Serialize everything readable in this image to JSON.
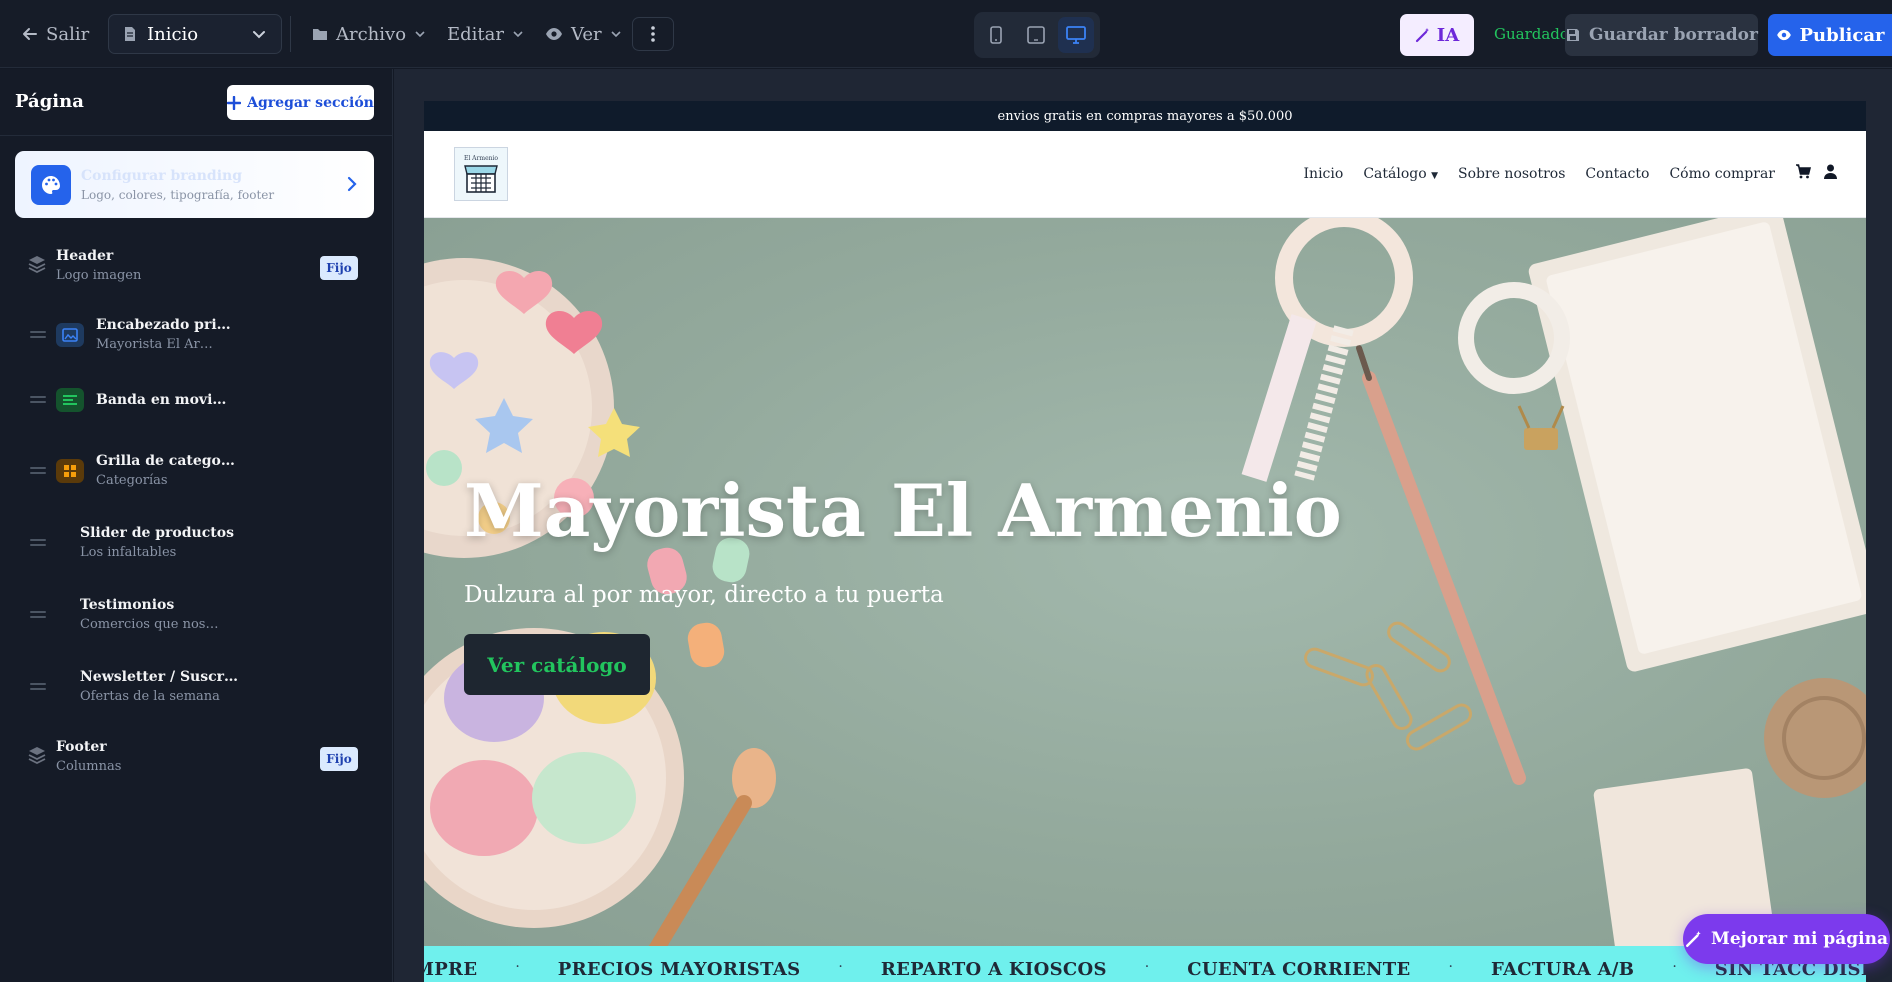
{
  "topbar": {
    "exit_label": "Salir",
    "page_select_value": "Inicio",
    "menu_archivo": "Archivo",
    "menu_editar": "Editar",
    "menu_ver": "Ver",
    "ia_label": "IA",
    "saved_status": "Guardado",
    "draft_label": "Guardar borrador",
    "publish_label": "Publicar",
    "active_device": "desktop"
  },
  "sidebar": {
    "title": "Página",
    "add_section_label": "Agregar sección",
    "branding": {
      "title": "Configurar branding",
      "subtitle": "Logo, colores, tipografía, footer"
    },
    "sections": [
      {
        "title": "Header",
        "subtitle": "Logo imagen",
        "badge": "Fijo",
        "icon": "layers-icon"
      },
      {
        "title": "Encabezado pri…",
        "subtitle": "Mayorista El Ar…",
        "icon": "image-icon",
        "color": "#2563eb"
      },
      {
        "title": "Banda en movi…",
        "subtitle": "",
        "icon": "lines-icon",
        "color": "#16a34a"
      },
      {
        "title": "Grilla de catego…",
        "subtitle": "Categorías",
        "icon": "grid-icon",
        "color": "#f59e0b"
      },
      {
        "title": "Slider de productos",
        "subtitle": "Los infaltables"
      },
      {
        "title": "Testimonios",
        "subtitle": "Comercios que nos…"
      },
      {
        "title": "Newsletter / Suscr…",
        "subtitle": "Ofertas de la semana"
      },
      {
        "title": "Footer",
        "subtitle": "Columnas",
        "badge": "Fijo",
        "icon": "layers-icon"
      }
    ]
  },
  "site": {
    "announcement": "envios gratis en compras mayores a $50.000",
    "logo_text": "El Armenio",
    "nav": [
      "Inicio",
      "Catálogo",
      "Sobre nosotros",
      "Contacto",
      "Cómo comprar"
    ],
    "hero_title": "Mayorista El Armenio",
    "hero_subtitle": "Dulzura al por mayor, directo a tu puerta",
    "hero_cta": "Ver catálogo",
    "marquee": [
      "MPRE",
      "PRECIOS MAYORISTAS",
      "REPARTO A KIOSCOS",
      "CUENTA CORRIENTE",
      "FACTURA A/B",
      "SIN TACC DISP"
    ],
    "marquee_separator": "·"
  },
  "improve_label": "Mejorar mi página",
  "colors": {
    "accent_blue": "#2563eb",
    "ia_purple": "#7c3aed",
    "saved_green": "#22c55e",
    "marquee_bg": "#6ff0ed"
  }
}
